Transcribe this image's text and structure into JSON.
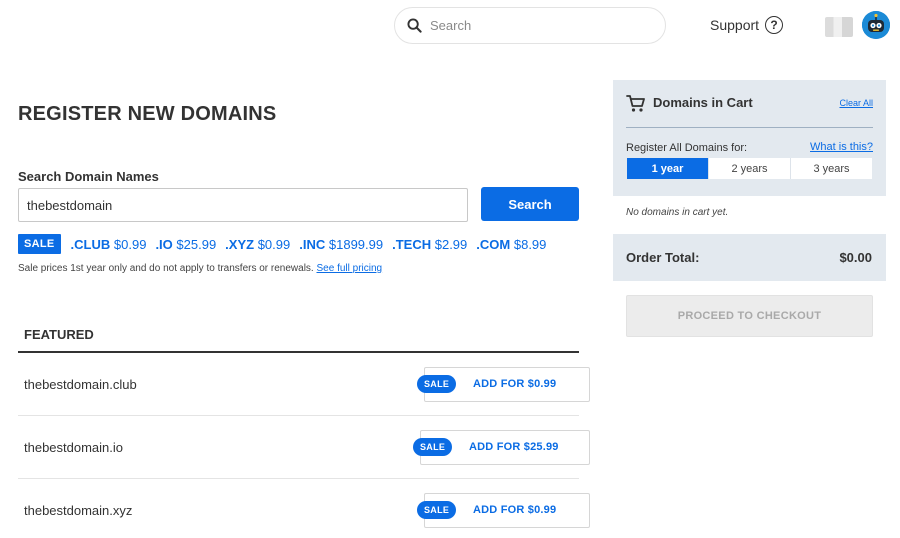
{
  "header": {
    "search_placeholder": "Search",
    "support_label": "Support",
    "support_icon": "?"
  },
  "main": {
    "title": "REGISTER NEW DOMAINS",
    "search_label": "Search Domain Names",
    "search_value": "thebestdomain",
    "search_button": "Search",
    "sale_tag": "SALE",
    "tlds": [
      {
        "ext": ".CLUB",
        "price": "$0.99"
      },
      {
        "ext": ".IO",
        "price": "$25.99"
      },
      {
        "ext": ".XYZ",
        "price": "$0.99"
      },
      {
        "ext": ".INC",
        "price": "$1899.99"
      },
      {
        "ext": ".TECH",
        "price": "$2.99"
      },
      {
        "ext": ".COM",
        "price": "$8.99"
      }
    ],
    "sale_note": "Sale prices 1st year only and do not apply to transfers or renewals.",
    "sale_note_link": "See full pricing",
    "featured_heading": "FEATURED",
    "featured": [
      {
        "domain": "thebestdomain.club",
        "badge": "SALE",
        "action": "ADD FOR $0.99"
      },
      {
        "domain": "thebestdomain.io",
        "badge": "SALE",
        "action": "ADD FOR $25.99"
      },
      {
        "domain": "thebestdomain.xyz",
        "badge": "SALE",
        "action": "ADD FOR $0.99"
      }
    ]
  },
  "cart": {
    "title": "Domains in Cart",
    "clear_all": "Clear All",
    "register_label": "Register All Domains for:",
    "what_is": "What is this?",
    "years": [
      "1 year",
      "2 years",
      "3 years"
    ],
    "selected_year": "1 year",
    "empty_text": "No domains in cart yet.",
    "order_total_label": "Order Total:",
    "order_total_value": "$0.00",
    "checkout_button": "PROCEED TO CHECKOUT"
  },
  "colors": {
    "accent": "#0b6ce4",
    "cart_bg": "#e3e9ef",
    "disabled_bg": "#ececec"
  },
  "icons": [
    "search-icon",
    "help-circle-icon",
    "cart-icon",
    "avatar-robot-icon"
  ]
}
